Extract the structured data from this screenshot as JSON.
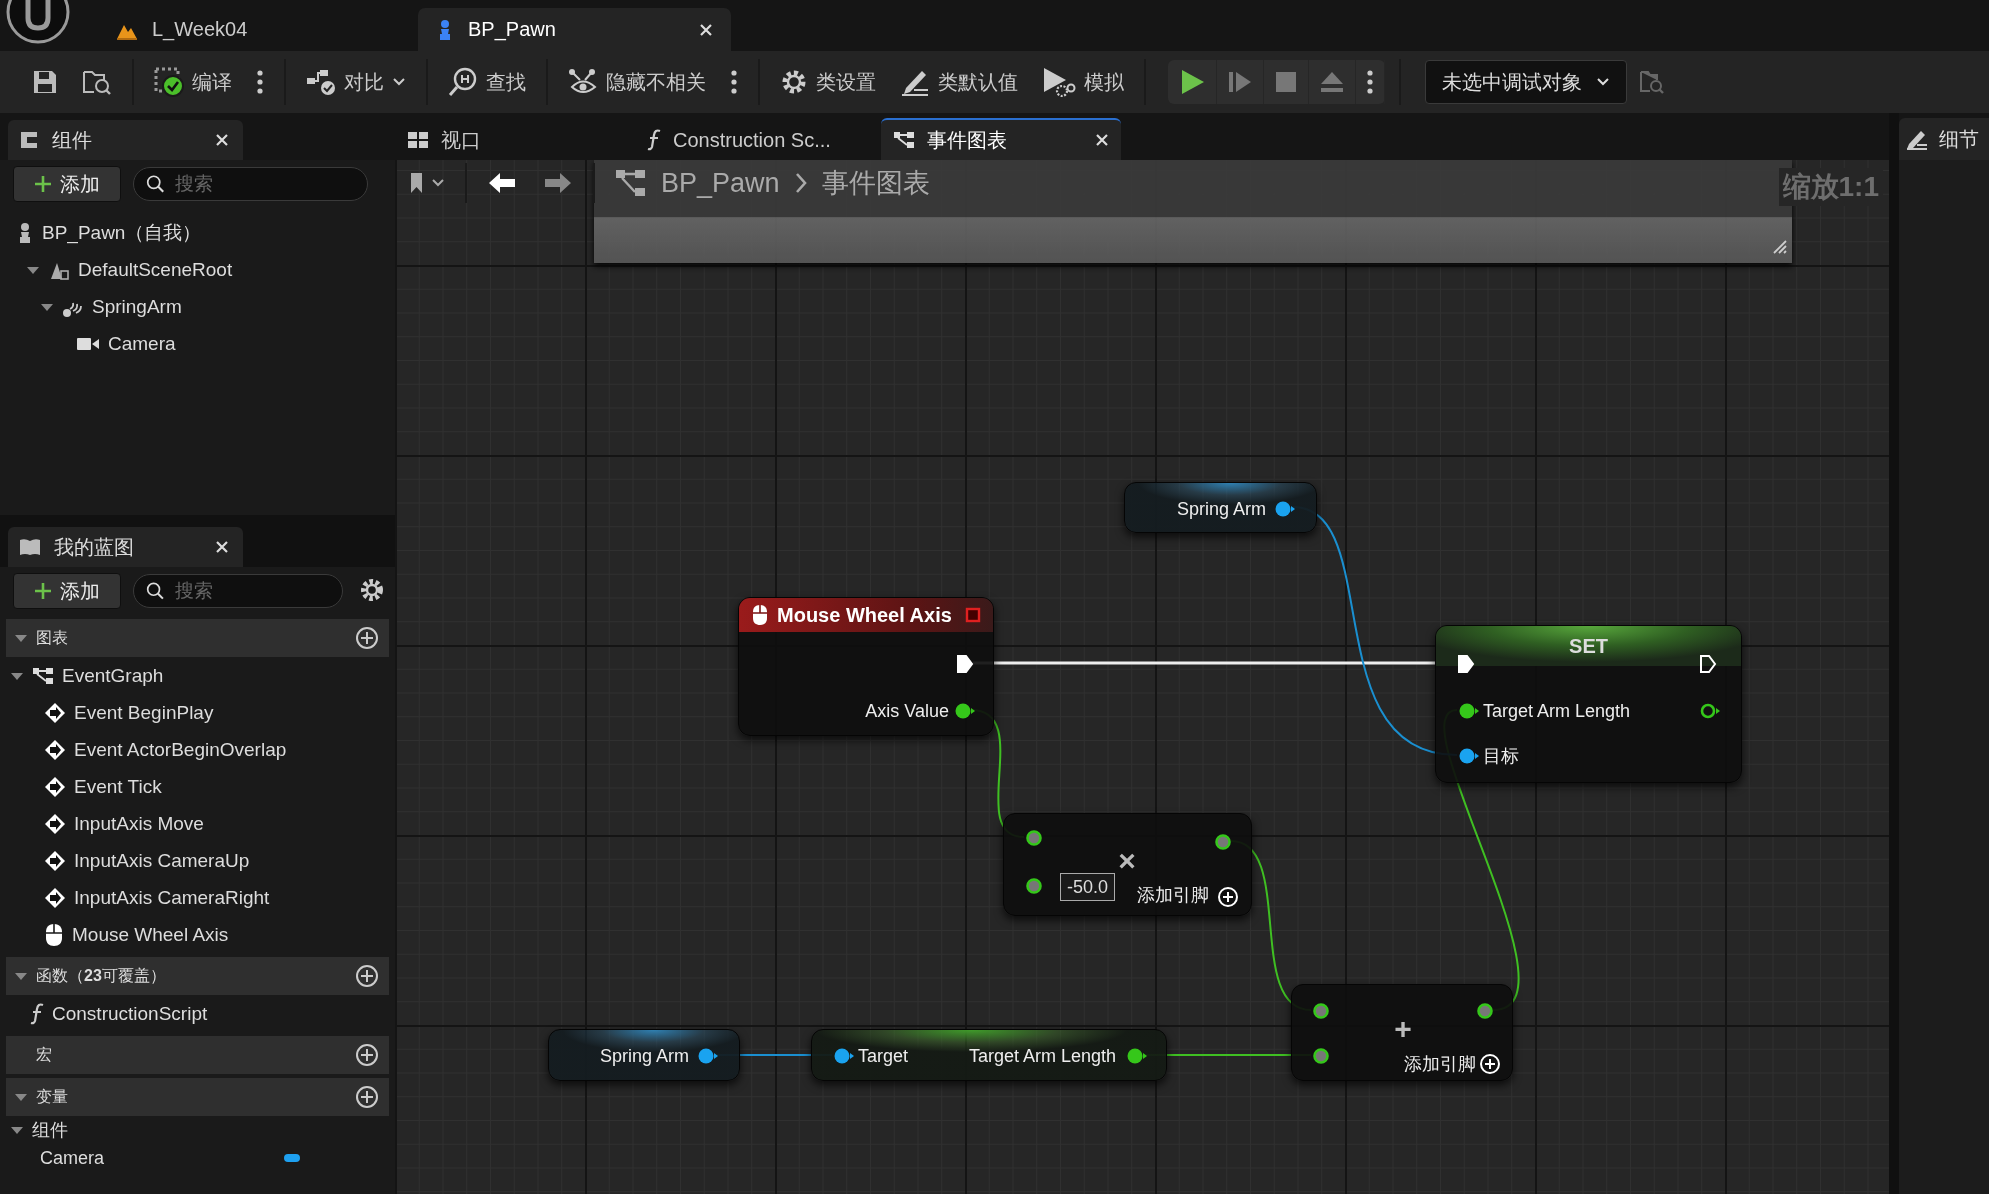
{
  "app_tabs": [
    {
      "label": "L_Week04",
      "kind": "level",
      "selected": false
    },
    {
      "label": "BP_Pawn",
      "kind": "blueprint",
      "selected": true
    }
  ],
  "toolbar": {
    "buttons": [
      {
        "kind": "compile",
        "label": "编译",
        "menu": true,
        "dropdown": false
      },
      {
        "kind": "diff",
        "label": "对比",
        "menu": false,
        "dropdown": true
      },
      {
        "kind": "find",
        "label": "查找",
        "menu": false,
        "dropdown": false
      },
      {
        "kind": "hide",
        "label": "隐藏不相关",
        "menu": true,
        "dropdown": false
      },
      {
        "kind": "settings",
        "label": "类设置",
        "menu": false,
        "dropdown": false
      },
      {
        "kind": "defaults",
        "label": "类默认值",
        "menu": false,
        "dropdown": false
      },
      {
        "kind": "simulate",
        "label": "模拟",
        "menu": false,
        "dropdown": false
      }
    ],
    "debug_object": "未选中调试对象"
  },
  "components_panel": {
    "title": "组件",
    "add_label": "添加",
    "search_placeholder": "搜索",
    "tree": [
      {
        "label": "BP_Pawn（自我）",
        "kind": "pawn"
      },
      {
        "label": "DefaultSceneRoot",
        "kind": "scene",
        "expanded": true,
        "children": [
          {
            "label": "SpringArm",
            "kind": "spring",
            "expanded": true,
            "children": [
              {
                "label": "Camera",
                "kind": "camera"
              }
            ]
          }
        ]
      }
    ]
  },
  "my_blueprint": {
    "title": "我的蓝图",
    "add_label": "添加",
    "search_placeholder": "搜索",
    "sections": [
      {
        "title": "图表",
        "expanded": true,
        "items": [
          {
            "label": "EventGraph",
            "kind": "graph",
            "expanded": true,
            "children": [
              {
                "label": "Event BeginPlay",
                "kind": "event"
              },
              {
                "label": "Event ActorBeginOverlap",
                "kind": "event"
              },
              {
                "label": "Event Tick",
                "kind": "event"
              },
              {
                "label": "InputAxis Move",
                "kind": "event"
              },
              {
                "label": "InputAxis CameraUp",
                "kind": "event"
              },
              {
                "label": "InputAxis CameraRight",
                "kind": "event"
              },
              {
                "label": "Mouse Wheel Axis",
                "kind": "mouse"
              }
            ]
          }
        ]
      },
      {
        "title": "函数（**23**可覆盖）",
        "expanded": true,
        "items": [
          {
            "label": "ConstructionScript",
            "kind": "function"
          }
        ]
      },
      {
        "title": "宏"
      },
      {
        "title": "变量",
        "expanded": true,
        "items": [
          {
            "label": "组件",
            "kind": "category",
            "expanded": true,
            "children": [
              {
                "label": "Camera",
                "kind": "variable"
              }
            ]
          }
        ]
      }
    ]
  },
  "editor_tabs": [
    {
      "label": "视口",
      "kind": "viewport",
      "selected": false
    },
    {
      "label": "Construction Sc...",
      "kind": "function",
      "selected": false
    },
    {
      "label": "事件图表",
      "kind": "graph",
      "selected": true
    }
  ],
  "graph": {
    "breadcrumb": [
      "BP_Pawn",
      "事件图表"
    ],
    "zoom_label": "缩放1:1",
    "nodes": [
      {
        "kind": "variable",
        "label": "Spring Arm"
      },
      {
        "kind": "event",
        "title": "Mouse Wheel Axis",
        "output_label": "Axis Value"
      },
      {
        "kind": "set",
        "title": "SET",
        "inputs": [
          "Target Arm Length",
          "目标"
        ]
      },
      {
        "kind": "math",
        "symbol": "×",
        "value": "-50.0",
        "add_pin_label": "添加引脚"
      },
      {
        "kind": "variable",
        "label": "Spring Arm"
      },
      {
        "kind": "getter",
        "input_label": "Target",
        "output_label": "Target Arm Length"
      },
      {
        "kind": "math",
        "symbol": "+",
        "add_pin_label": "添加引脚"
      }
    ]
  },
  "details_tab": "细节"
}
